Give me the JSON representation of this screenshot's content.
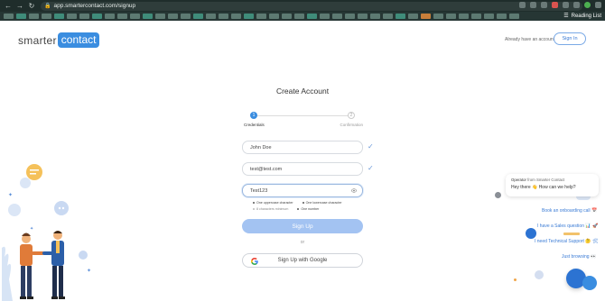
{
  "browser": {
    "url": "app.smartercontact.com/signup",
    "reading_list_label": "Reading List"
  },
  "header": {
    "logo_word1": "smarter",
    "logo_word2": "contact",
    "already_text": "Already have an account?",
    "signin_label": "Sign In"
  },
  "form": {
    "title": "Create Account",
    "steps": [
      {
        "number": "1",
        "label": "Credentials"
      },
      {
        "number": "2",
        "label": "Confirmation"
      }
    ],
    "name_value": "John Doe",
    "email_value": "test@test.com",
    "password_value": "Test123",
    "rules": [
      {
        "text": "One uppercase character",
        "met": true
      },
      {
        "text": "One lowercase character",
        "met": true
      },
      {
        "text": "8 characters minimum",
        "met": false
      },
      {
        "text": "One number",
        "met": true
      }
    ],
    "signup_label": "Sign Up",
    "or_label": "or",
    "google_label": "Sign Up with Google"
  },
  "chat": {
    "operator_name": "Operator",
    "operator_from": "from Smarter Contact",
    "greeting": "Hey there 👋 How can we help?",
    "quick_replies": [
      "Book an onboarding call 📅",
      "I have a Sales question 📊 🚀",
      "I need Technical Support 🤔 🛠",
      "Just browsing 👀"
    ]
  },
  "colors": {
    "brand_blue": "#3a8de0",
    "button_disabled": "#a3c3f2",
    "check_blue": "#6a98d8"
  }
}
